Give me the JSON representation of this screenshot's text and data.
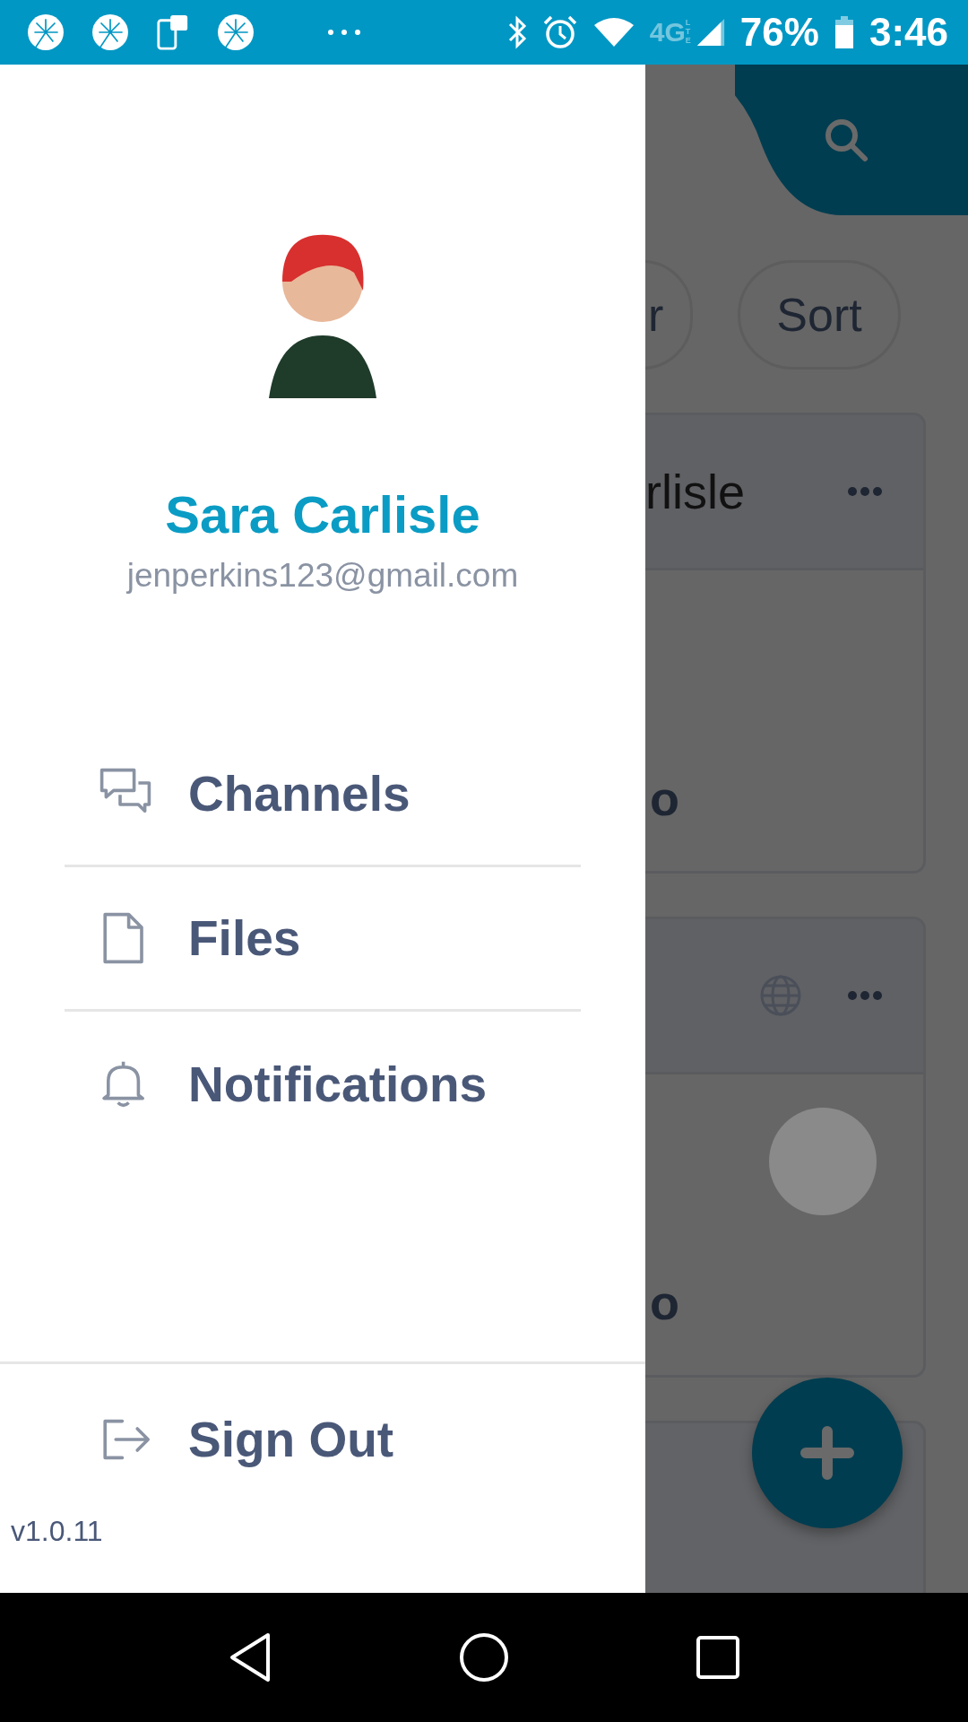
{
  "status_bar": {
    "network": "4G",
    "network_sub": "LTE",
    "battery": "76%",
    "time": "3:46"
  },
  "background": {
    "chips": [
      {
        "label": "r"
      },
      {
        "label": "Sort"
      }
    ],
    "cards": [
      {
        "title": "rlisle",
        "body": "o",
        "public": false,
        "image": false
      },
      {
        "body": "o",
        "public": true,
        "image": true
      }
    ]
  },
  "drawer": {
    "user": {
      "name": "Sara Carlisle",
      "email": "jenperkins123@gmail.com"
    },
    "menu": [
      {
        "kind": "channels",
        "label": "Channels"
      },
      {
        "kind": "files",
        "label": "Files"
      },
      {
        "kind": "notifications",
        "label": "Notifications"
      }
    ],
    "sign_out": "Sign Out",
    "version": "v1.0.11"
  }
}
